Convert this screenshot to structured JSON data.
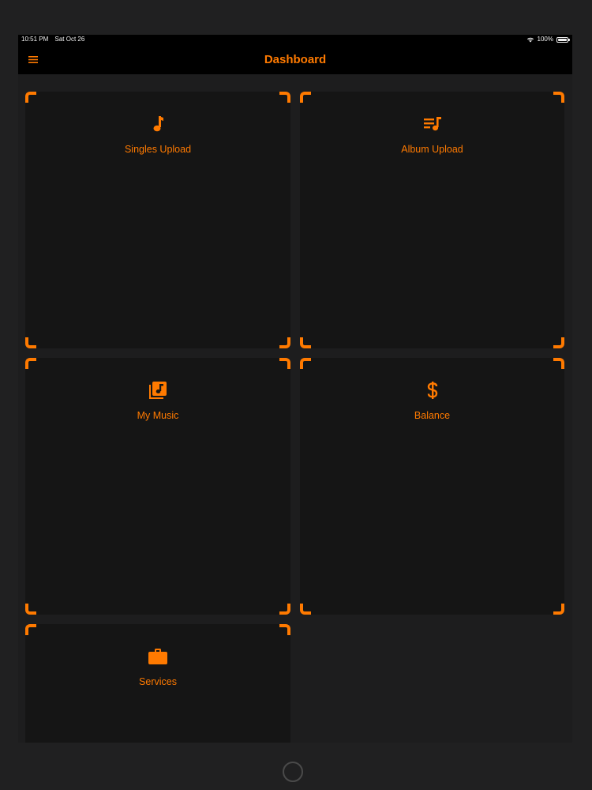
{
  "status_bar": {
    "time": "10:51 PM",
    "date": "Sat Oct 26",
    "battery": "100%"
  },
  "nav": {
    "title": "Dashboard",
    "menu_icon": "hamburger-menu-icon"
  },
  "cards": [
    {
      "label": "Singles Upload",
      "icon": "music-note-icon"
    },
    {
      "label": "Album Upload",
      "icon": "playlist-music-icon"
    },
    {
      "label": "My Music",
      "icon": "music-library-icon"
    },
    {
      "label": "Balance",
      "icon": "dollar-sign-icon"
    },
    {
      "label": "Services",
      "icon": "briefcase-icon"
    }
  ],
  "colors": {
    "accent": "#ff7a00",
    "card_background": "#151515",
    "screen_background": "#1d1d1e",
    "nav_background": "#000000"
  }
}
